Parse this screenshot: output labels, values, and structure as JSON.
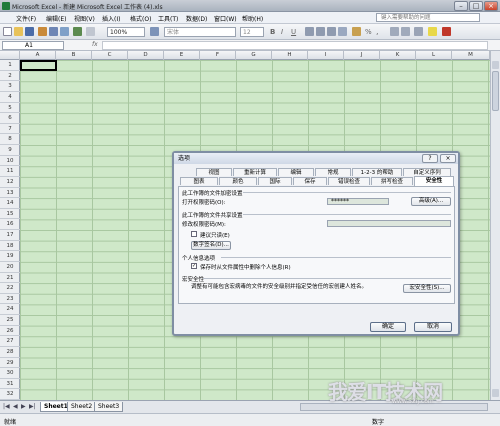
{
  "window": {
    "title": "Microsoft Excel - 新建 Microsoft Excel 工作表 (4).xls",
    "minimize": "–",
    "maximize": "□",
    "close": "×"
  },
  "menu": {
    "items": [
      "文件(F)",
      "编辑(E)",
      "视图(V)",
      "插入(I)",
      "格式(O)",
      "工具(T)",
      "数据(D)",
      "窗口(W)",
      "帮助(H)"
    ],
    "help_placeholder": "键入需要帮助的问题"
  },
  "toolbar": {
    "zoom": "100%",
    "font": "宋体",
    "size": "12",
    "bold": "B",
    "italic": "I",
    "underline": "U",
    "percent": "%",
    "comma": ","
  },
  "formula": {
    "cell_ref": "A1",
    "fx": "fx"
  },
  "columns": [
    "A",
    "B",
    "C",
    "D",
    "E",
    "F",
    "G",
    "H",
    "I",
    "J",
    "K",
    "L",
    "M"
  ],
  "rows": [
    "1",
    "2",
    "3",
    "4",
    "5",
    "6",
    "7",
    "8",
    "9",
    "10",
    "11",
    "12",
    "13",
    "14",
    "15",
    "16",
    "17",
    "18",
    "19",
    "20",
    "21",
    "22",
    "23",
    "24",
    "25",
    "26",
    "27",
    "28",
    "29",
    "30",
    "31",
    "32"
  ],
  "sheets": [
    "Sheet1",
    "Sheet2",
    "Sheet3"
  ],
  "status": {
    "left": "就绪",
    "right": "数字"
  },
  "dialog": {
    "title": "选项",
    "help_btn": "?",
    "close_btn": "×",
    "tabs_row1": [
      "视图",
      "重新计算",
      "编辑",
      "常规",
      "1-2-3 的帮助",
      "自定义序列"
    ],
    "tabs_row2": [
      "图表",
      "颜色",
      "国际",
      "保存",
      "错误检查",
      "拼写检查",
      "安全性"
    ],
    "active_tab": "安全性",
    "section1": "此工作簿的文件加密设置",
    "open_pwd_label": "打开权限密码(O):",
    "open_pwd_value": "******",
    "advanced_btn": "高级(A)...",
    "section2": "此工作簿的文件共享设置",
    "modify_pwd_label": "修改权限密码(M):",
    "readonly_label": "建议只读(E)",
    "digital_sig_btn": "数字签名(D)...",
    "section3": "个人信息选项",
    "remove_info_label": "保存时从文件属性中删除个人信息(R)",
    "section4": "宏安全性",
    "macro_desc": "调整有可能包含宏病毒的文件的安全级别并指定受信任的宏创建人姓名。",
    "macro_btn": "宏安全性(S)...",
    "ok": "确定",
    "cancel": "取消"
  },
  "watermark": {
    "text": "我爱IT技术网",
    "url": "www.52ij.com"
  }
}
